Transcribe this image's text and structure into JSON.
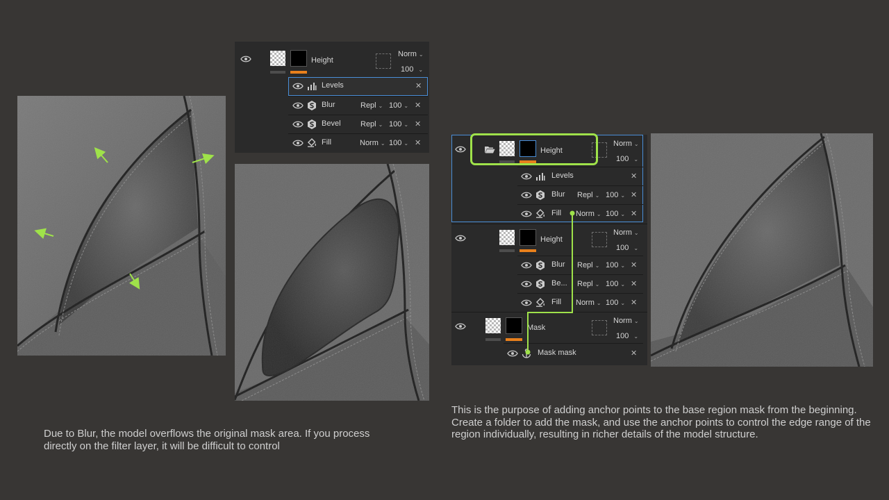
{
  "colors": {
    "accent_green": "#9fe24a",
    "selection_blue": "#4a8ed8",
    "orange": "#e8801c",
    "background": "#383634"
  },
  "panel_top": {
    "layer": {
      "name": "Height",
      "blend": "Norm",
      "opacity": "100"
    },
    "filters": [
      {
        "name": "Levels",
        "icon": "levels-icon",
        "blend": "",
        "opacity": "",
        "selected": true
      },
      {
        "name": "Blur",
        "icon": "substance-icon",
        "blend": "Repl",
        "opacity": "100"
      },
      {
        "name": "Bevel",
        "icon": "substance-icon",
        "blend": "Repl",
        "opacity": "100"
      },
      {
        "name": "Fill",
        "icon": "fill-bucket-icon",
        "blend": "Norm",
        "opacity": "100"
      }
    ]
  },
  "panel_right": {
    "folder": {
      "name": "Height",
      "blend": "Norm",
      "opacity": "100"
    },
    "folder_filters": [
      {
        "name": "Levels",
        "icon": "levels-icon"
      },
      {
        "name": "Blur",
        "icon": "substance-icon",
        "blend": "Repl",
        "opacity": "100"
      },
      {
        "name": "Fill",
        "icon": "fill-bucket-icon",
        "blend": "Norm",
        "opacity": "100"
      }
    ],
    "layer2": {
      "name": "Height",
      "blend": "Norm",
      "opacity": "100"
    },
    "layer2_filters": [
      {
        "name": "Blur",
        "icon": "substance-icon",
        "blend": "Repl",
        "opacity": "100"
      },
      {
        "name": "Be...",
        "icon": "substance-icon",
        "blend": "Repl",
        "opacity": "100"
      },
      {
        "name": "Fill",
        "icon": "fill-bucket-icon",
        "blend": "Norm",
        "opacity": "100"
      }
    ],
    "mask_layer": {
      "name": "Mask",
      "blend": "Norm",
      "opacity": "100"
    },
    "mask_filter": {
      "name": "Mask mask",
      "icon": "anchor-icon"
    }
  },
  "captions": {
    "left": "Due to Blur, the model overflows the original mask area. If you process directly on the filter layer, it will be difficult to control",
    "right": "This is the purpose of adding anchor points to the base region mask from the beginning. Create a folder to add the mask, and use the anchor points to control the edge range of the region individually, resulting in richer details of the model structure."
  }
}
